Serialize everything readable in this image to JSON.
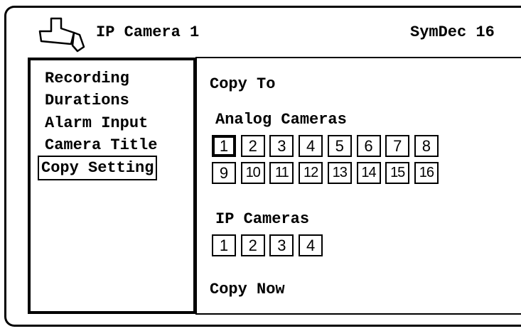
{
  "header": {
    "title": "IP Camera 1",
    "right_text": "SymDec 16"
  },
  "sidebar": {
    "items": [
      {
        "label": "Recording"
      },
      {
        "label": "Durations"
      },
      {
        "label": "Alarm Input"
      },
      {
        "label": "Camera Title"
      },
      {
        "label": "Copy Setting",
        "selected": true
      }
    ]
  },
  "main": {
    "copy_to_label": "Copy To",
    "analog_label": "Analog Cameras",
    "analog_cameras": [
      "1",
      "2",
      "3",
      "4",
      "5",
      "6",
      "7",
      "8",
      "9",
      "10",
      "11",
      "12",
      "13",
      "14",
      "15",
      "16"
    ],
    "analog_selected": "1",
    "ip_label": "IP Cameras",
    "ip_cameras": [
      "1",
      "2",
      "3",
      "4"
    ],
    "copy_now_label": "Copy Now"
  },
  "icons": {
    "header_icon": "camera-icon"
  }
}
